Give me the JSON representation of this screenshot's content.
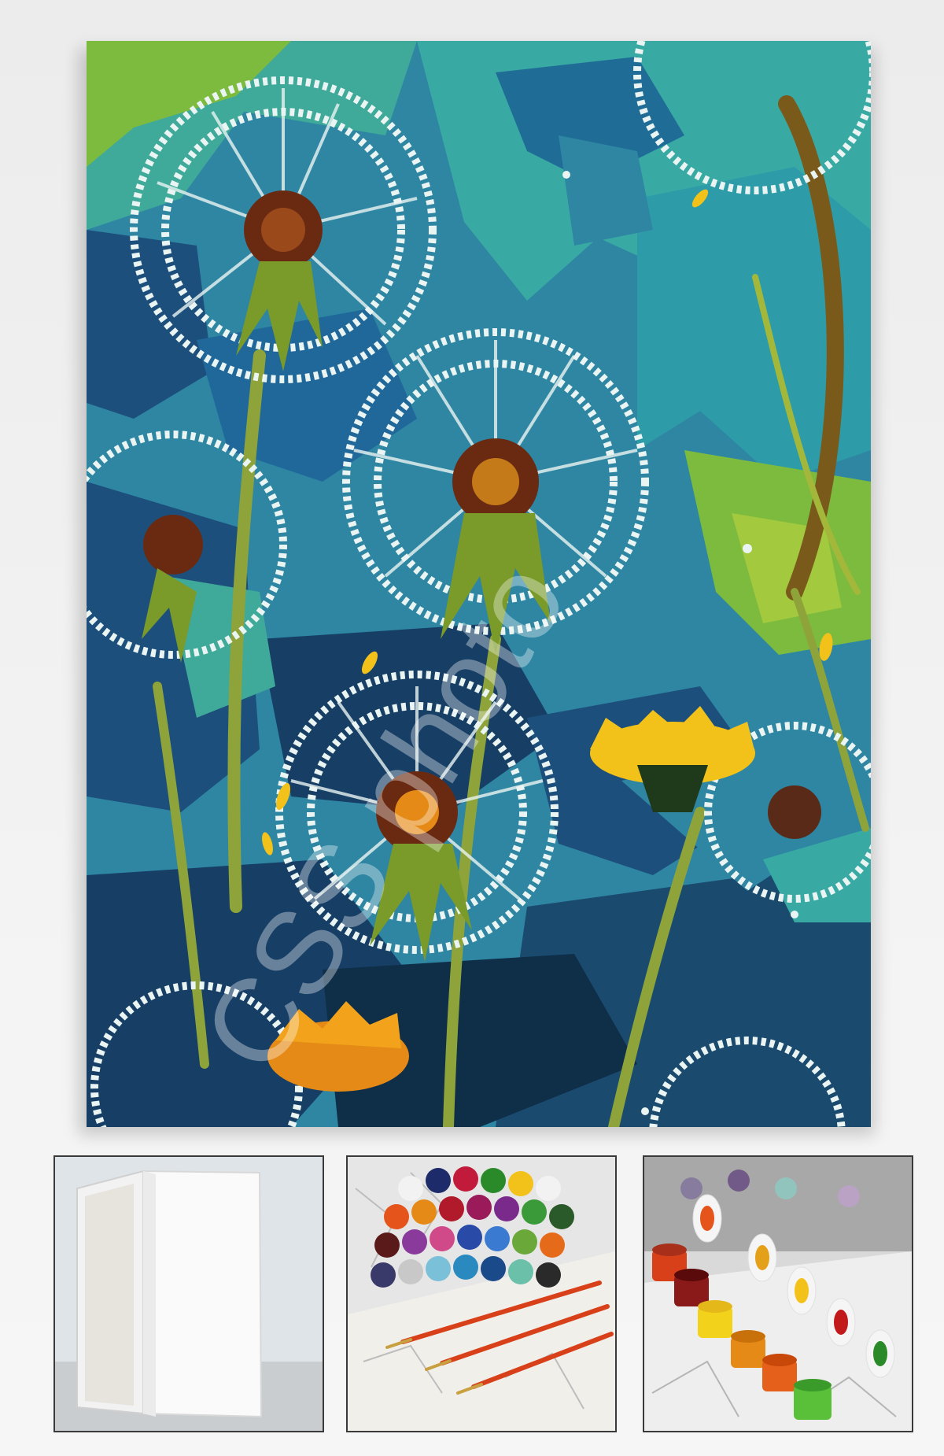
{
  "watermark": {
    "text": "CSS photo"
  },
  "colors": {
    "background": "#f0f0f0",
    "sky_deep": "#1d4f7c",
    "sky_mid": "#2e86a3",
    "sky_teal": "#39a9a4",
    "leaf_green": "#7dbb3f",
    "seed_white": "#eaf4f2",
    "flower_yellow": "#f2c21b",
    "flower_orange": "#e58a16",
    "center_brown": "#6a2a12",
    "stem": "#8ea43a"
  },
  "thumbnails": [
    {
      "icon": "blank-canvas-icon"
    },
    {
      "icon": "paint-pots-brushes-icon"
    },
    {
      "icon": "open-paint-pots-icon"
    }
  ]
}
